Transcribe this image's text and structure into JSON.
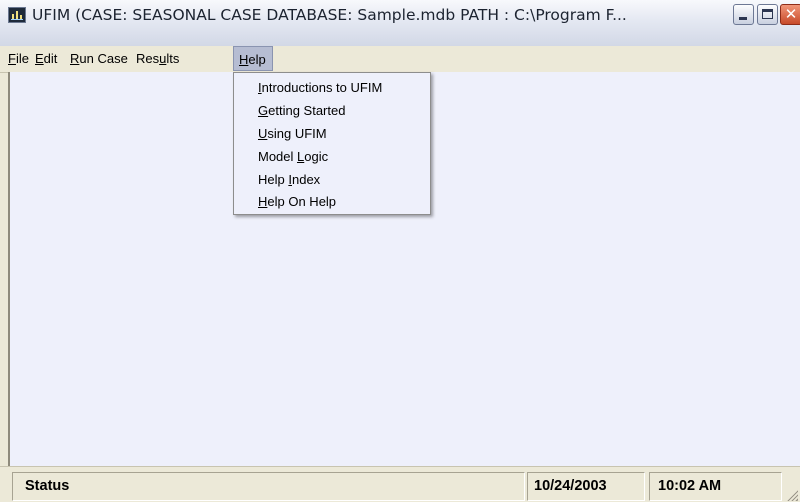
{
  "window": {
    "title": "UFIM (CASE: SEASONAL CASE   DATABASE: Sample.mdb   PATH : C:\\Program F...",
    "icon": "ufim-app-icon",
    "caption_buttons": {
      "minimize": "minimize-icon",
      "maximize": "maximize-icon",
      "close_glyph": "✕"
    }
  },
  "menubar": {
    "items": [
      {
        "label": "File",
        "mnemonic": "F",
        "rest": "ile"
      },
      {
        "label": "Edit",
        "mnemonic": "E",
        "rest": "dit"
      },
      {
        "label": "Run Case",
        "mnemonic": "R",
        "rest": "un Case"
      },
      {
        "label": "Results",
        "pre": "Res",
        "mnemonic": "u",
        "rest": "lts"
      },
      {
        "label": "Help",
        "mnemonic": "H",
        "rest": "elp",
        "active": true
      }
    ]
  },
  "help_menu": {
    "items": [
      {
        "label": "Introductions to UFIM",
        "mnemonic": "I",
        "rest": "ntroductions to UFIM"
      },
      {
        "label": "Getting Started",
        "mnemonic": "G",
        "rest": "etting Started"
      },
      {
        "label": "Using UFIM",
        "mnemonic": "U",
        "rest": "sing UFIM"
      },
      {
        "label": "Model Logic",
        "pre": "Model ",
        "mnemonic": "L",
        "rest": "ogic"
      },
      {
        "label": "Help Index",
        "pre": "Help ",
        "mnemonic": "I",
        "rest": "ndex"
      },
      {
        "label": "Help On Help",
        "mnemonic": "H",
        "rest": "elp On Help"
      }
    ]
  },
  "statusbar": {
    "status": "Status",
    "date": "10/24/2003",
    "time": "10:02 AM"
  },
  "colors": {
    "client_bg": "#eef0fb",
    "menu_highlight": "#b6bdd2",
    "close_button": "#c74a2a",
    "chrome": "#ece9d8"
  }
}
